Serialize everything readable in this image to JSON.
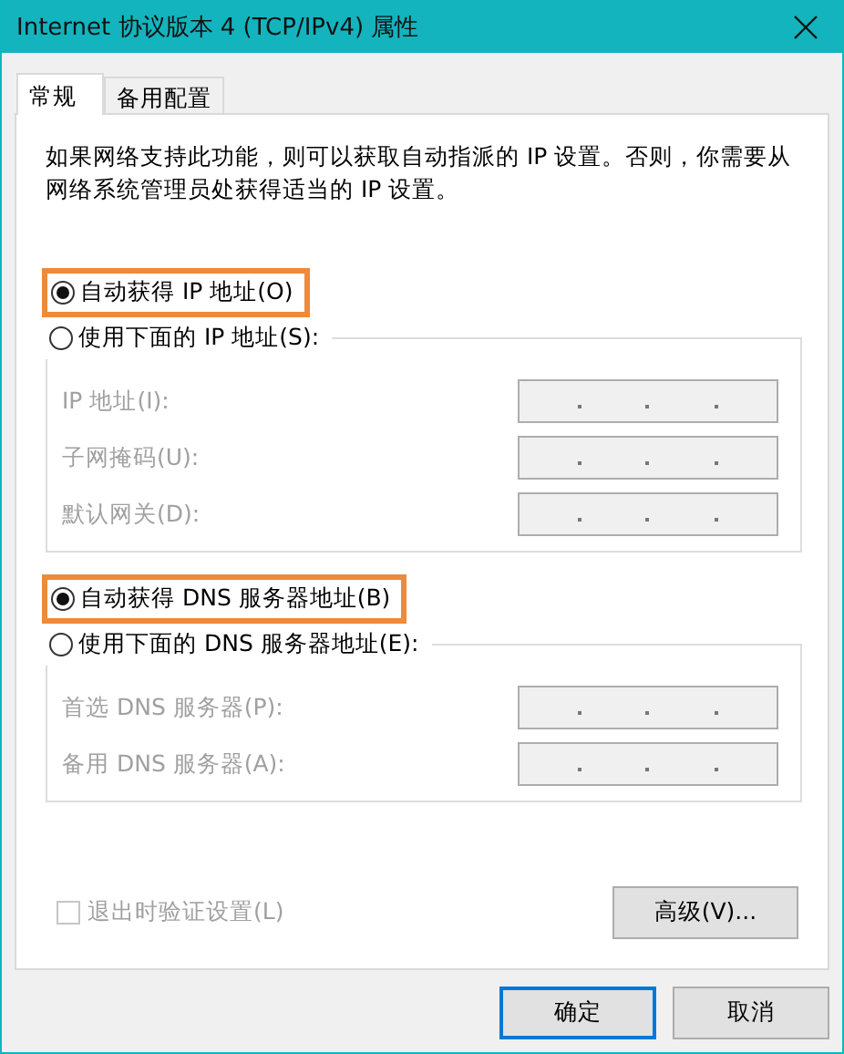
{
  "window": {
    "title": "Internet 协议版本 4 (TCP/IPv4) 属性"
  },
  "tabs": [
    {
      "label": "常规",
      "selected": true
    },
    {
      "label": "备用配置",
      "selected": false
    }
  ],
  "description": "如果网络支持此功能，则可以获取自动指派的 IP 设置。否则，你需要从网络系统管理员处获得适当的 IP 设置。",
  "ip_section": {
    "options": [
      {
        "label": "自动获得 IP 地址(O)",
        "selected": true,
        "highlighted": true
      },
      {
        "label": "使用下面的 IP 地址(S):",
        "selected": false,
        "highlighted": false
      }
    ],
    "fields": [
      {
        "label": "IP 地址(I):",
        "disabled": true
      },
      {
        "label": "子网掩码(U):",
        "disabled": true
      },
      {
        "label": "默认网关(D):",
        "disabled": true
      }
    ]
  },
  "dns_section": {
    "options": [
      {
        "label": "自动获得 DNS 服务器地址(B)",
        "selected": true,
        "highlighted": true
      },
      {
        "label": "使用下面的 DNS 服务器地址(E):",
        "selected": false,
        "highlighted": false
      }
    ],
    "fields": [
      {
        "label": "首选 DNS 服务器(P):",
        "disabled": true
      },
      {
        "label": "备用 DNS 服务器(A):",
        "disabled": true
      }
    ]
  },
  "validate_on_exit": {
    "label": "退出时验证设置(L)",
    "checked": false,
    "disabled": true
  },
  "advanced_button": "高级(V)...",
  "buttons": [
    {
      "label": "确定",
      "default": true
    },
    {
      "label": "取消",
      "default": false
    }
  ]
}
